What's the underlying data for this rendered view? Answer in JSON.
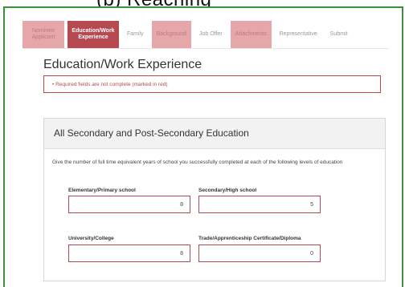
{
  "caption": "(b) Reaching",
  "tabs": [
    {
      "label": "Nominee Applicant",
      "state": "visited"
    },
    {
      "label": "Education/Work Experience",
      "state": "active"
    },
    {
      "label": "Family",
      "state": "plain"
    },
    {
      "label": "Background",
      "state": "visited"
    },
    {
      "label": "Job Offer",
      "state": "plain"
    },
    {
      "label": "Attachments",
      "state": "visited"
    },
    {
      "label": "Representative",
      "state": "plain"
    },
    {
      "label": "Submit",
      "state": "plain"
    }
  ],
  "page_title": "Education/Work Experience",
  "error_message": "• Required fields are not complete (marked in red)",
  "panel": {
    "title": "All Secondary and Post-Secondary Education",
    "description": "Give the number of full time equivalent years of school you successfully completed at each of the following levels of education",
    "fields": {
      "elementary": {
        "label": "Elementary/Primary school",
        "value": "8"
      },
      "secondary": {
        "label": "Secondary/High school",
        "value": "5"
      },
      "university": {
        "label": "University/College",
        "value": "8"
      },
      "trade": {
        "label": "Trade/Apprenticeship Certificate/Diploma",
        "value": "0"
      }
    }
  },
  "colors": {
    "accent": "#b74a51",
    "accent_light": "#e6a7ab",
    "frame": "#3f8f3a"
  }
}
